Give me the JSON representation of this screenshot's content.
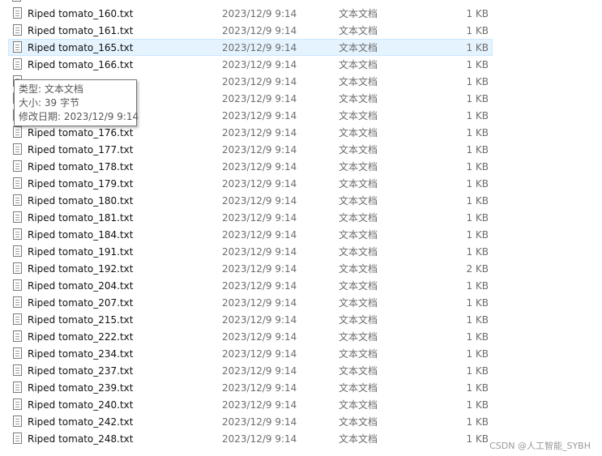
{
  "files": [
    {
      "name": "Riped tomato_160.txt",
      "date": "2023/12/9 9:14",
      "type": "文本文档",
      "size": "1 KB"
    },
    {
      "name": "Riped tomato_161.txt",
      "date": "2023/12/9 9:14",
      "type": "文本文档",
      "size": "1 KB"
    },
    {
      "name": "Riped tomato_165.txt",
      "date": "2023/12/9 9:14",
      "type": "文本文档",
      "size": "1 KB",
      "selected": true
    },
    {
      "name": "Riped tomato_166.txt",
      "date": "2023/12/9 9:14",
      "type": "文本文档",
      "size": "1 KB"
    },
    {
      "name": "",
      "date": "2023/12/9 9:14",
      "type": "文本文档",
      "size": "1 KB"
    },
    {
      "name": "",
      "date": "2023/12/9 9:14",
      "type": "文本文档",
      "size": "1 KB"
    },
    {
      "name": "",
      "date": "2023/12/9 9:14",
      "type": "文本文档",
      "size": "1 KB"
    },
    {
      "name": "Riped tomato_176.txt",
      "date": "2023/12/9 9:14",
      "type": "文本文档",
      "size": "1 KB"
    },
    {
      "name": "Riped tomato_177.txt",
      "date": "2023/12/9 9:14",
      "type": "文本文档",
      "size": "1 KB"
    },
    {
      "name": "Riped tomato_178.txt",
      "date": "2023/12/9 9:14",
      "type": "文本文档",
      "size": "1 KB"
    },
    {
      "name": "Riped tomato_179.txt",
      "date": "2023/12/9 9:14",
      "type": "文本文档",
      "size": "1 KB"
    },
    {
      "name": "Riped tomato_180.txt",
      "date": "2023/12/9 9:14",
      "type": "文本文档",
      "size": "1 KB"
    },
    {
      "name": "Riped tomato_181.txt",
      "date": "2023/12/9 9:14",
      "type": "文本文档",
      "size": "1 KB"
    },
    {
      "name": "Riped tomato_184.txt",
      "date": "2023/12/9 9:14",
      "type": "文本文档",
      "size": "1 KB"
    },
    {
      "name": "Riped tomato_191.txt",
      "date": "2023/12/9 9:14",
      "type": "文本文档",
      "size": "1 KB"
    },
    {
      "name": "Riped tomato_192.txt",
      "date": "2023/12/9 9:14",
      "type": "文本文档",
      "size": "2 KB"
    },
    {
      "name": "Riped tomato_204.txt",
      "date": "2023/12/9 9:14",
      "type": "文本文档",
      "size": "1 KB"
    },
    {
      "name": "Riped tomato_207.txt",
      "date": "2023/12/9 9:14",
      "type": "文本文档",
      "size": "1 KB"
    },
    {
      "name": "Riped tomato_215.txt",
      "date": "2023/12/9 9:14",
      "type": "文本文档",
      "size": "1 KB"
    },
    {
      "name": "Riped tomato_222.txt",
      "date": "2023/12/9 9:14",
      "type": "文本文档",
      "size": "1 KB"
    },
    {
      "name": "Riped tomato_234.txt",
      "date": "2023/12/9 9:14",
      "type": "文本文档",
      "size": "1 KB"
    },
    {
      "name": "Riped tomato_237.txt",
      "date": "2023/12/9 9:14",
      "type": "文本文档",
      "size": "1 KB"
    },
    {
      "name": "Riped tomato_239.txt",
      "date": "2023/12/9 9:14",
      "type": "文本文档",
      "size": "1 KB"
    },
    {
      "name": "Riped tomato_240.txt",
      "date": "2023/12/9 9:14",
      "type": "文本文档",
      "size": "1 KB"
    },
    {
      "name": "Riped tomato_242.txt",
      "date": "2023/12/9 9:14",
      "type": "文本文档",
      "size": "1 KB"
    },
    {
      "name": "Riped tomato_248.txt",
      "date": "2023/12/9 9:14",
      "type": "文本文档",
      "size": "1 KB"
    }
  ],
  "tooltip": {
    "type_line": "类型: 文本文档",
    "size_line": "大小: 39 字节",
    "modified_line": "修改日期: 2023/12/9 9:14"
  },
  "watermark": "CSDN @人工智能_SYBH",
  "icons": {
    "file": "text-file-icon"
  },
  "colors": {
    "selected_bg": "#e5f3ff",
    "selected_border": "#cce8ff",
    "detail_text": "#6d6d6d"
  }
}
